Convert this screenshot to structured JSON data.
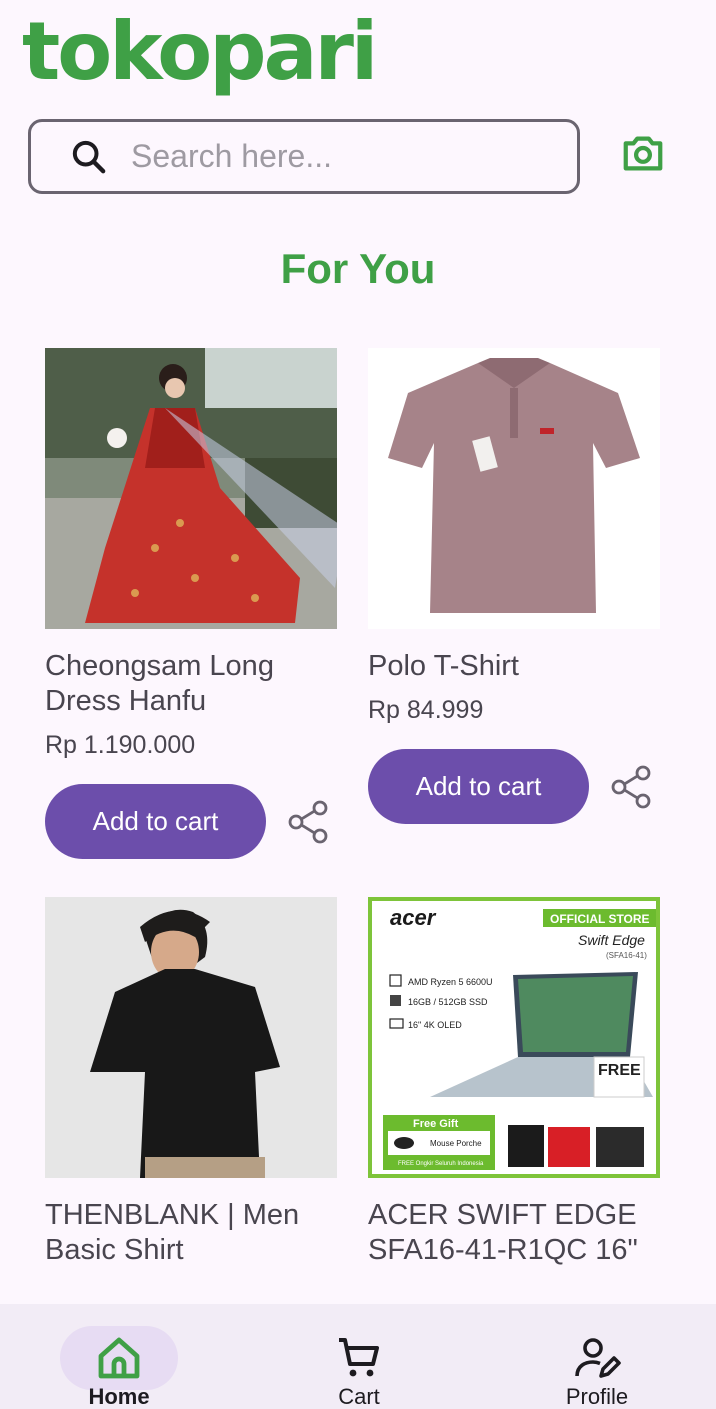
{
  "app": {
    "logo": "tokopari"
  },
  "search": {
    "placeholder": "Search here..."
  },
  "icons": {
    "search": "search-icon",
    "camera": "camera-icon",
    "share": "share-icon",
    "home": "home-icon",
    "cart": "cart-icon",
    "profile": "profile-icon"
  },
  "colors": {
    "brand": "#3fa046",
    "primary": "#6c4eab",
    "nav_bg": "#f2ecf6"
  },
  "section": {
    "title": "For You"
  },
  "products": [
    {
      "name": "Cheongsam Long Dress Hanfu",
      "price": "Rp 1.190.000",
      "cta": "Add to cart"
    },
    {
      "name": "Polo T-Shirt",
      "price": "Rp 84.999",
      "cta": "Add to cart"
    },
    {
      "name": "THENBLANK | Men Basic Shirt"
    },
    {
      "name": "ACER SWIFT EDGE SFA16-41-R1QC 16\""
    }
  ],
  "acer_ad": {
    "brand": "acer",
    "badge": "OFFICIAL STORE",
    "model": "Swift Edge",
    "model_code": "(SFA16-41)",
    "specs": [
      "AMD Ryzen 5 6600U",
      "16GB / 512GB SSD",
      "16\" 4K OLED"
    ],
    "free_label": "FREE",
    "gift_label": "Free Gift",
    "gift_item": "Mouse Porche",
    "gift_note": "FREE Ongkir Seluruh Indonesia"
  },
  "nav": {
    "items": [
      {
        "label": "Home",
        "active": true
      },
      {
        "label": "Cart",
        "active": false
      },
      {
        "label": "Profile",
        "active": false
      }
    ]
  }
}
